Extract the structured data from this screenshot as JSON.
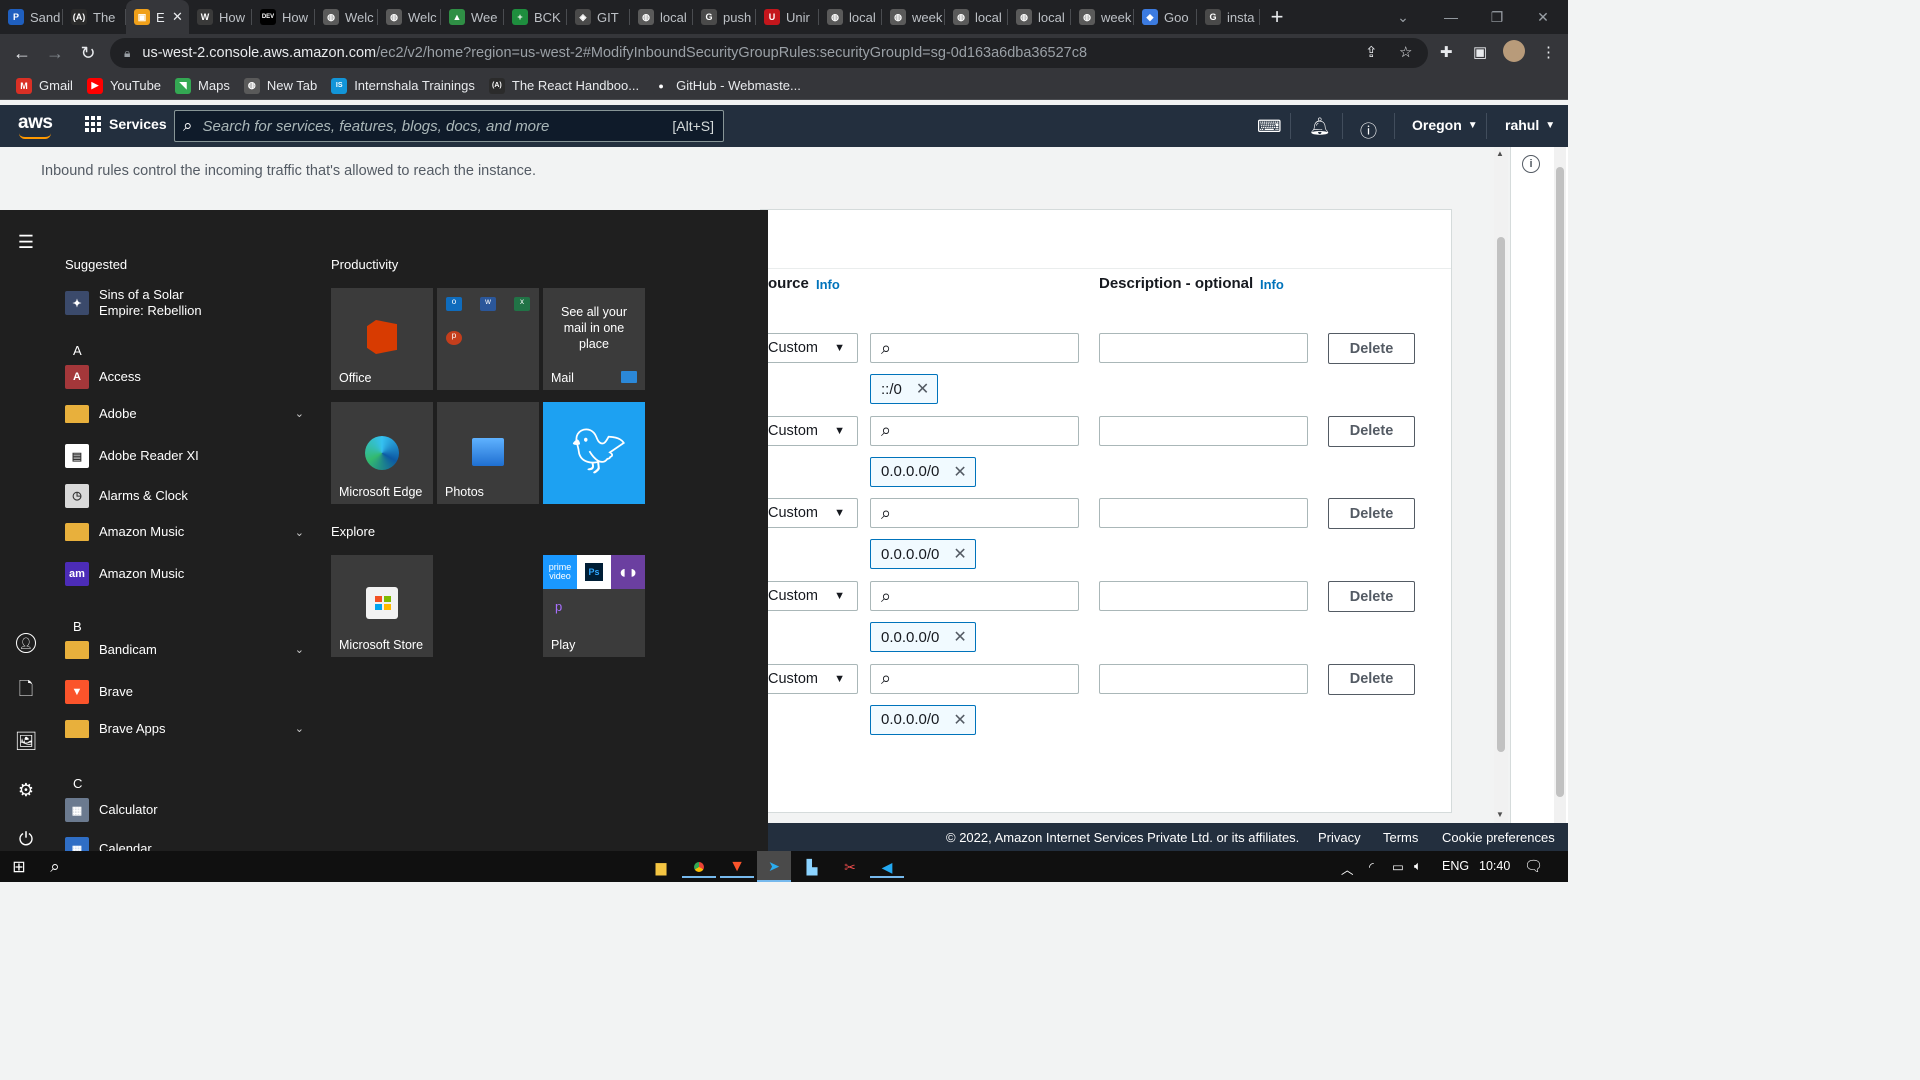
{
  "browser": {
    "tabs": [
      {
        "title": "Sand",
        "icon": "paypal-icon",
        "color": "#1f5fbf",
        "glyph": "P"
      },
      {
        "title": "The",
        "icon": "react-icon",
        "color": "#2b2b2b",
        "glyph": "(A)"
      },
      {
        "title": "E",
        "icon": "aws-icon",
        "color": "#f0a01a",
        "glyph": "▣",
        "active": true
      },
      {
        "title": "How",
        "icon": "wordpress-icon",
        "color": "#3a3a3a",
        "glyph": "W"
      },
      {
        "title": "How",
        "icon": "dev-icon",
        "color": "#000000",
        "glyph": "DEV"
      },
      {
        "title": "Welc",
        "icon": "globe-icon",
        "color": "#5a5a5a",
        "glyph": "◍"
      },
      {
        "title": "Welc",
        "icon": "globe-icon",
        "color": "#5a5a5a",
        "glyph": "◍"
      },
      {
        "title": "Wee",
        "icon": "drive-icon",
        "color": "#2f8f45",
        "glyph": "▲"
      },
      {
        "title": "BCK",
        "icon": "sheets-icon",
        "color": "#1e8e3e",
        "glyph": "+"
      },
      {
        "title": "GIT",
        "icon": "git-icon",
        "color": "#4a4a4a",
        "glyph": "◈"
      },
      {
        "title": "local",
        "icon": "globe-icon",
        "color": "#5a5a5a",
        "glyph": "◍"
      },
      {
        "title": "push",
        "icon": "google-icon",
        "color": "#4a4a4a",
        "glyph": "G"
      },
      {
        "title": "Unir",
        "icon": "unir-icon",
        "color": "#c4161c",
        "glyph": "U"
      },
      {
        "title": "local",
        "icon": "globe-icon",
        "color": "#5a5a5a",
        "glyph": "◍"
      },
      {
        "title": "week",
        "icon": "globe-icon",
        "color": "#5a5a5a",
        "glyph": "◍"
      },
      {
        "title": "local",
        "icon": "globe-icon",
        "color": "#5a5a5a",
        "glyph": "◍"
      },
      {
        "title": "local",
        "icon": "globe-icon",
        "color": "#5a5a5a",
        "glyph": "◍"
      },
      {
        "title": "week",
        "icon": "globe-icon",
        "color": "#5a5a5a",
        "glyph": "◍"
      },
      {
        "title": "Goo",
        "icon": "google-cloud-icon",
        "color": "#3c7be0",
        "glyph": "◆"
      },
      {
        "title": "insta",
        "icon": "google-icon",
        "color": "#4a4a4a",
        "glyph": "G"
      }
    ],
    "active_tab_close": "✕",
    "new_tab": "+",
    "url_host": "us-west-2.console.aws.amazon.com",
    "url_path": "/ec2/v2/home?region=us-west-2#ModifyInboundSecurityGroupRules:securityGroupId=sg-0d163a6dba36527c8",
    "bookmarks": [
      {
        "label": "Gmail",
        "icon": "gmail-icon",
        "color": "#d93025",
        "glyph": "M"
      },
      {
        "label": "YouTube",
        "icon": "youtube-icon",
        "color": "#ff0000",
        "glyph": "▶"
      },
      {
        "label": "Maps",
        "icon": "maps-icon",
        "color": "#34a853",
        "glyph": "◥"
      },
      {
        "label": "New Tab",
        "icon": "globe-icon",
        "color": "#5a5a5a",
        "glyph": "◍"
      },
      {
        "label": "Internshala Trainings",
        "icon": "internshala-icon",
        "color": "#1295d8",
        "glyph": "IS"
      },
      {
        "label": "The React Handboo...",
        "icon": "react-icon",
        "color": "#2b2b2b",
        "glyph": "(A)"
      },
      {
        "label": "GitHub - Webmaste...",
        "icon": "github-icon",
        "color": "#35363a",
        "glyph": "●"
      }
    ]
  },
  "aws": {
    "logo": "aws",
    "services_label": "Services",
    "search_placeholder": "Search for services, features, blogs, docs, and more",
    "search_shortcut": "[Alt+S]",
    "region": "Oregon",
    "user": "rahul",
    "intro_text": "Inbound rules control the incoming traffic that's allowed to reach the instance.",
    "columns": {
      "source": "ource",
      "source_info": "Info",
      "description": "Description - optional",
      "description_info": "Info"
    },
    "rules": [
      {
        "source_type": "Custom",
        "token": "::/0",
        "delete_label": "Delete"
      },
      {
        "source_type": "Custom",
        "token": "0.0.0.0/0",
        "delete_label": "Delete"
      },
      {
        "source_type": "Custom",
        "token": "0.0.0.0/0",
        "delete_label": "Delete"
      },
      {
        "source_type": "Custom",
        "token": "0.0.0.0/0",
        "delete_label": "Delete"
      },
      {
        "source_type": "Custom",
        "token": "0.0.0.0/0",
        "delete_label": "Delete"
      }
    ],
    "footer": {
      "copyright": "© 2022, Amazon Internet Services Private Ltd. or its affiliates.",
      "privacy": "Privacy",
      "terms": "Terms",
      "cookies": "Cookie preferences"
    }
  },
  "start_menu": {
    "suggested_heading": "Suggested",
    "productivity_heading": "Productivity",
    "explore_heading": "Explore",
    "apps": [
      {
        "type": "app",
        "label": "Sins of a Solar\nEmpire: Rebellion",
        "icon": "sins-icon",
        "color": "#3b4a6b",
        "glyph": "✦"
      },
      {
        "type": "letter",
        "label": "A"
      },
      {
        "type": "app",
        "label": "Access",
        "icon": "access-icon",
        "color": "#a4373a",
        "glyph": "A"
      },
      {
        "type": "app",
        "label": "Adobe",
        "icon": "folder-icon",
        "color": "#e8b03c",
        "glyph": "",
        "expand": true
      },
      {
        "type": "app",
        "label": "Adobe Reader XI",
        "icon": "pdf-icon",
        "color": "#ffffff",
        "glyph": "▤"
      },
      {
        "type": "app",
        "label": "Alarms & Clock",
        "icon": "clock-icon",
        "color": "#d9d9d9",
        "glyph": "◷"
      },
      {
        "type": "app",
        "label": "Amazon Music",
        "icon": "folder-icon",
        "color": "#e8b03c",
        "glyph": "",
        "expand": true
      },
      {
        "type": "app",
        "label": "Amazon Music",
        "icon": "amazon-music-icon",
        "color": "#4c2cb8",
        "glyph": "am"
      },
      {
        "type": "letter",
        "label": "B"
      },
      {
        "type": "app",
        "label": "Bandicam",
        "icon": "folder-icon",
        "color": "#e8b03c",
        "glyph": "",
        "expand": true
      },
      {
        "type": "app",
        "label": "Brave",
        "icon": "brave-icon",
        "color": "#fb542b",
        "glyph": "▼"
      },
      {
        "type": "app",
        "label": "Brave Apps",
        "icon": "folder-icon",
        "color": "#e8b03c",
        "glyph": "",
        "expand": true
      },
      {
        "type": "letter",
        "label": "C"
      },
      {
        "type": "app",
        "label": "Calculator",
        "icon": "calculator-icon",
        "color": "#6b7a8f",
        "glyph": "▦"
      },
      {
        "type": "app",
        "label": "Calendar",
        "icon": "calendar-icon",
        "color": "#2f6ec5",
        "glyph": "▦"
      }
    ],
    "tiles": {
      "office": "Office",
      "mail_text": "See all your mail in one place",
      "mail": "Mail",
      "edge": "Microsoft Edge",
      "photos": "Photos",
      "store": "Microsoft Store",
      "play": "Play",
      "play_prime": "prime video",
      "play_ps": "Ps"
    }
  },
  "taskbar": {
    "lang": "ENG",
    "time": "10:40"
  }
}
